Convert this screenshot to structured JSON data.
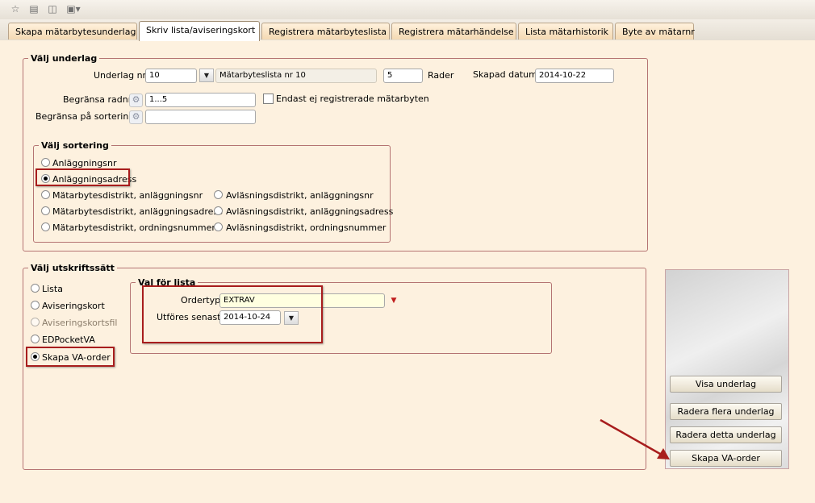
{
  "toolbar": {
    "icons": [
      "back-icon",
      "print-icon",
      "print-preview-icon",
      "export-icon"
    ]
  },
  "tabs": [
    {
      "label": "Skapa mätarbytesunderlag",
      "active": false
    },
    {
      "label": "Skriv lista/aviseringskort",
      "active": true
    },
    {
      "label": "Registrera mätarbyteslista",
      "active": false
    },
    {
      "label": "Registrera mätarhändelse",
      "active": false
    },
    {
      "label": "Lista mätarhistorik",
      "active": false
    },
    {
      "label": "Byte av mätarnr",
      "active": false
    }
  ],
  "underlag": {
    "legend": "Välj underlag",
    "nr_label": "Underlag nr",
    "nr_value": "10",
    "list_name": "Mätarbyteslista nr 10",
    "rows_value": "5",
    "rows_label": "Rader",
    "created_label": "Skapad datum",
    "created_value": "2014-10-22",
    "limit_rows_label": "Begränsa radnr",
    "limit_rows_value": "1...5",
    "only_unregistered_label": "Endast ej registrerade mätarbyten",
    "only_unregistered_checked": false,
    "limit_sort_label": "Begränsa på sortering",
    "limit_sort_value": ""
  },
  "sortering": {
    "legend": "Välj sortering",
    "options": [
      {
        "label": "Anläggningsnr",
        "selected": false
      },
      {
        "label": "Anläggningsadress",
        "selected": true
      },
      {
        "label": "Mätarbytesdistrikt, anläggningsnr",
        "selected": false
      },
      {
        "label": "Mätarbytesdistrikt, anläggningsadress",
        "selected": false
      },
      {
        "label": "Mätarbytesdistrikt, ordningsnummer",
        "selected": false
      },
      {
        "label": "Avläsningsdistrikt, anläggningsnr",
        "selected": false
      },
      {
        "label": "Avläsningsdistrikt, anläggningsadress",
        "selected": false
      },
      {
        "label": "Avläsningsdistrikt, ordningsnummer",
        "selected": false
      }
    ]
  },
  "utskrift": {
    "legend": "Välj utskriftssätt",
    "options": [
      {
        "label": "Lista",
        "selected": false,
        "enabled": true
      },
      {
        "label": "Aviseringskort",
        "selected": false,
        "enabled": true
      },
      {
        "label": "Aviseringskortsfil",
        "selected": false,
        "enabled": false
      },
      {
        "label": "EDPocketVA",
        "selected": false,
        "enabled": true
      },
      {
        "label": "Skapa VA-order",
        "selected": true,
        "enabled": true
      }
    ],
    "val": {
      "legend": "Val för lista",
      "ordertyp_label": "Ordertyp",
      "ordertyp_value": "EXTRAV",
      "utfores_label": "Utföres senast",
      "utfores_value": "2014-10-24"
    }
  },
  "actions": {
    "visa": "Visa underlag",
    "radera_flera": "Radera flera underlag",
    "radera_detta": "Radera detta underlag",
    "skapa_va_order": "Skapa VA-order"
  },
  "colors": {
    "background": "#fdf1df",
    "highlight": "#a81d1d",
    "group_border": "#b57473"
  }
}
